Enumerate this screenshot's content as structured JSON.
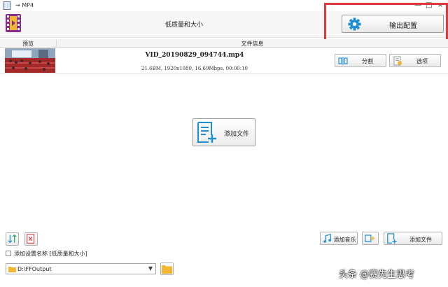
{
  "window": {
    "title": "→ MP4",
    "minimize": "—",
    "maximize": "□",
    "close": "×"
  },
  "header": {
    "profile_name": "低质量和大小",
    "output_config_label": "输出配置"
  },
  "columns": {
    "preview": "预览",
    "file_info": "文件信息"
  },
  "file": {
    "name": "VID_20190829_094744.mp4",
    "meta": "21.6BM, 1920x1080, 16.69Mbps, 00:00:10",
    "split_label": "分割",
    "options_label": "选项"
  },
  "center": {
    "add_file_label": "添加文件"
  },
  "bottom": {
    "add_music_label": "添加音乐",
    "add_file_label": "添加文件",
    "add_setting_name_label": "添加设置名称 [低质量和大小]",
    "output_folder": "D:\\FFOutput"
  },
  "watermark": "头条 @赛先生思考",
  "colors": {
    "accent_blue": "#1e8fd0",
    "highlight_red": "#e0383b",
    "icon_purple": "#8a2a8a"
  }
}
